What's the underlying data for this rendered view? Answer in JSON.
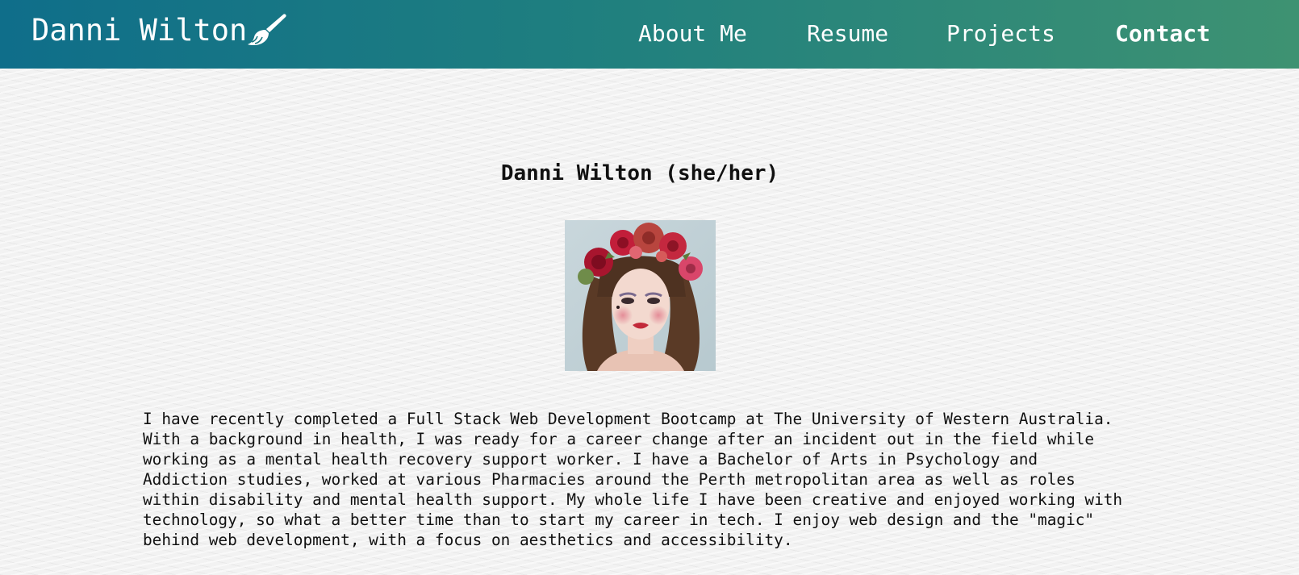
{
  "header": {
    "brand_name": "Danni Wilton",
    "brand_icon": "paintbrush-icon",
    "nav": [
      {
        "label": "About Me",
        "active": false
      },
      {
        "label": "Resume",
        "active": false
      },
      {
        "label": "Projects",
        "active": false
      },
      {
        "label": "Contact",
        "active": true
      }
    ],
    "gradient_start": "#0f6e8a",
    "gradient_end": "#3e9272"
  },
  "main": {
    "title": "Danni Wilton (she/her)",
    "photo_icon": "profile-photo",
    "bio": "I have recently completed a Full Stack Web Development Bootcamp at The University of Western Australia. With a background in health, I was ready for a career change after an incident out in the field while working as a mental health recovery support worker. I have a Bachelor of Arts in Psychology and Addiction studies, worked at various Pharmacies around the Perth metropolitan area as well as roles within disability and mental health support. My whole life I have been creative and enjoyed working with technology, so what a better time than to start my career in tech. I enjoy web design and the \"magic\" behind web development, with a focus on aesthetics and accessibility."
  }
}
